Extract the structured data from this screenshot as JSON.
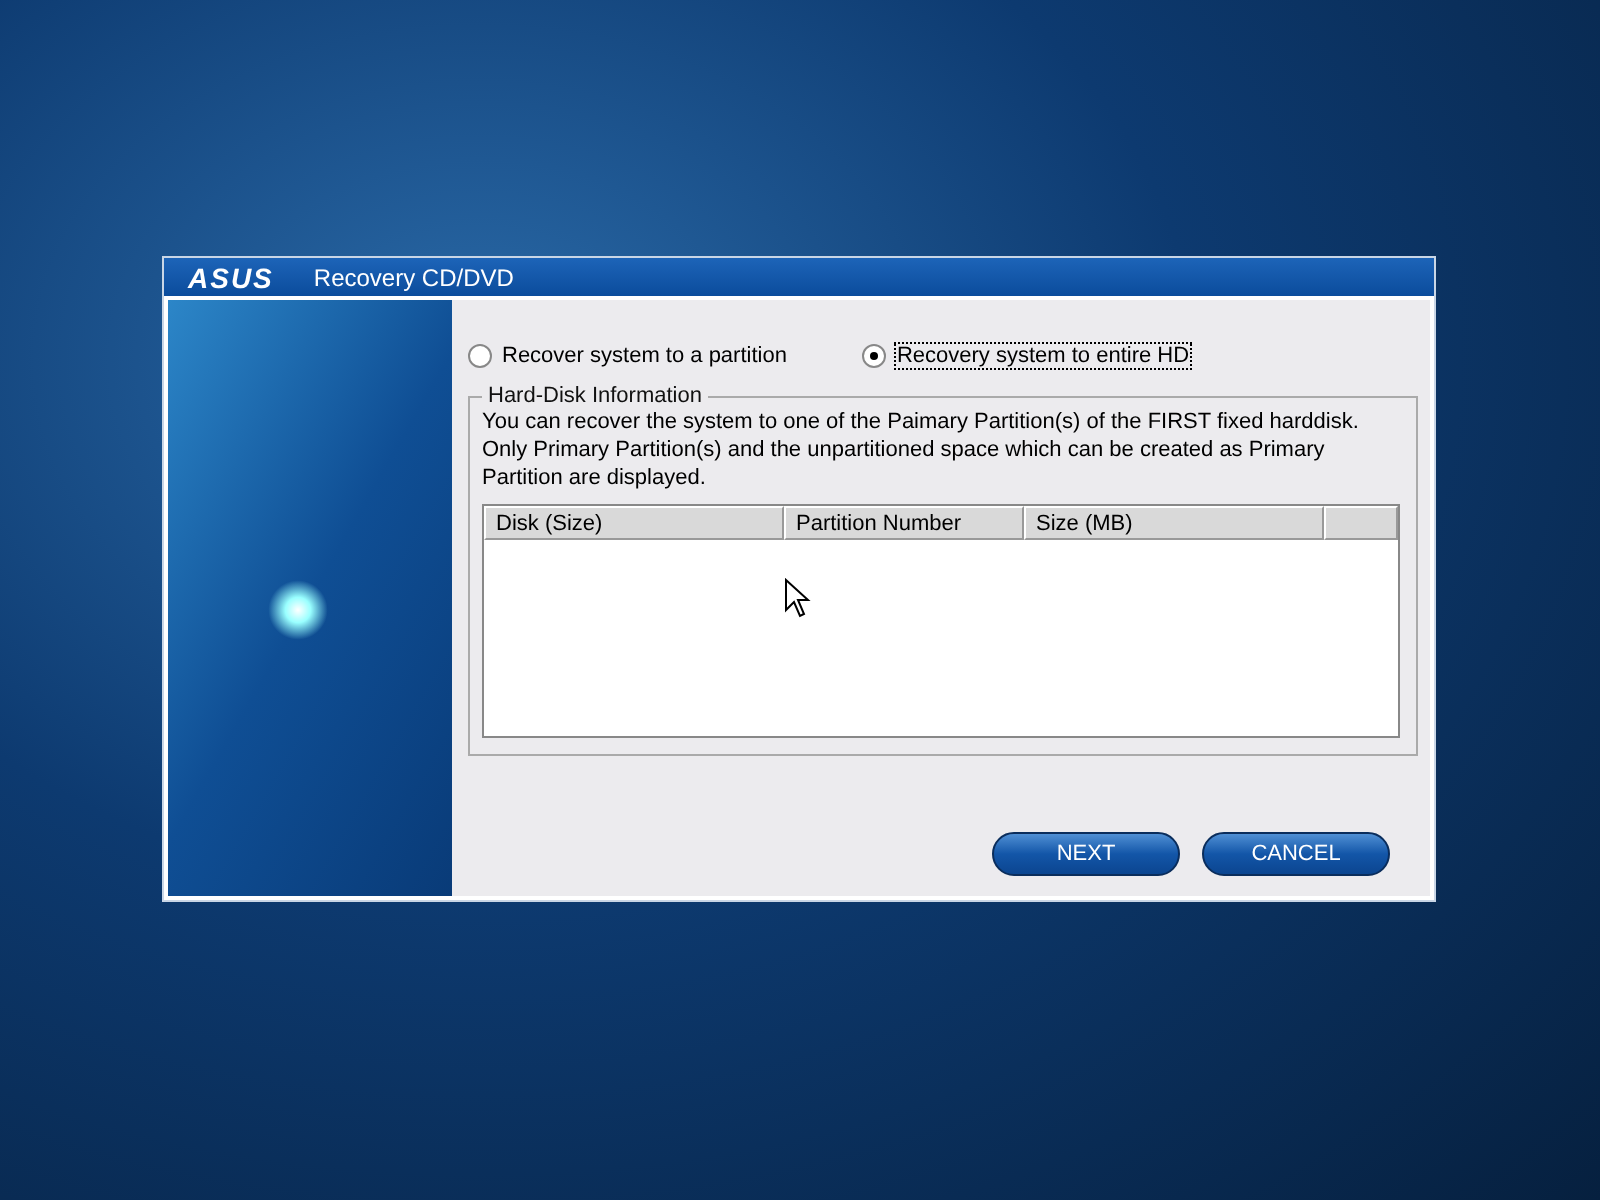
{
  "window": {
    "logo": "ASUS",
    "title": "Recovery CD/DVD"
  },
  "options": [
    {
      "label": "Recover system to a partition",
      "selected": false
    },
    {
      "label": "Recovery system to entire HD",
      "selected": true
    }
  ],
  "group": {
    "title": "Hard-Disk Information",
    "description": "You can recover the system to one of the Paimary Partition(s) of the FIRST fixed harddisk. Only Primary Partition(s) and the unpartitioned space which can be created as Primary Partition are displayed."
  },
  "table": {
    "columns": [
      "Disk (Size)",
      "Partition Number",
      "Size (MB)"
    ]
  },
  "buttons": [
    "NEXT",
    "CANCEL"
  ]
}
